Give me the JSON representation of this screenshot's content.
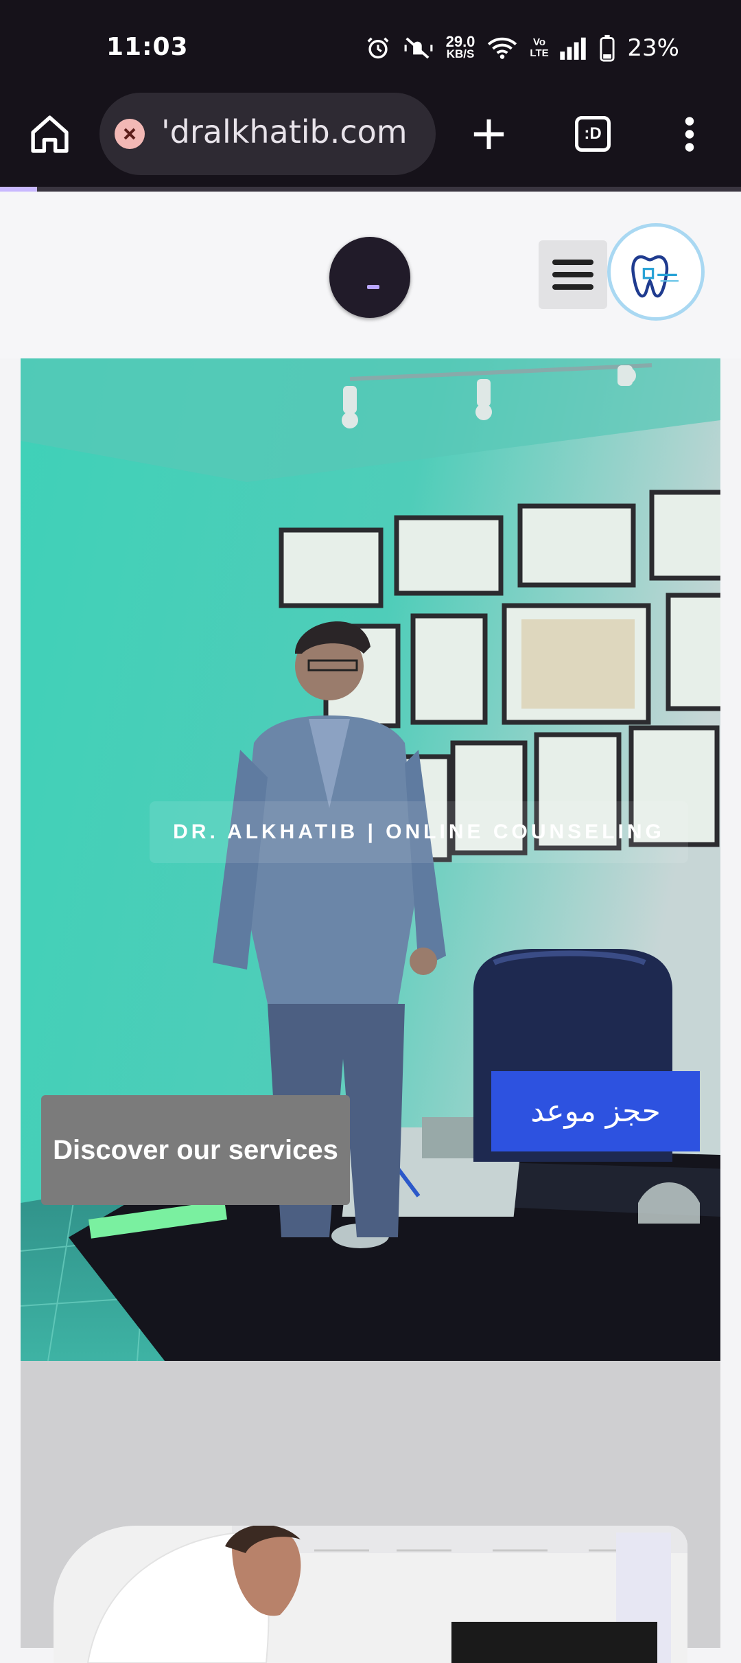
{
  "status_bar": {
    "time": "11:03",
    "net_speed_value": "29.0",
    "net_speed_unit": "KB/S",
    "volte": "Vo\nLTE",
    "battery": "23%",
    "icons": [
      "alarm-icon",
      "mute-vibrate-icon",
      "wifi-icon",
      "volte-icon",
      "signal-icon",
      "battery-icon"
    ]
  },
  "browser": {
    "url": "'dralkhatib.com",
    "tabs_label": ":D",
    "load_progress": 0.05,
    "icons": [
      "home-icon",
      "site-error-icon",
      "new-tab-icon",
      "tabs-icon",
      "more-menu-icon"
    ]
  },
  "header": {
    "menu_icon": "hamburger-icon",
    "logo": "tooth-logo"
  },
  "hero": {
    "title": "DR. ALKHATIB | ONLINE COUNSELING",
    "book_button": "حجز موعد",
    "discover_button": "Discover our services"
  },
  "colors": {
    "status_bg": "#16121a",
    "header_bg": "#f6f6f8",
    "hero_tint": "#3fd1b8",
    "book_button": "#2d52e0",
    "discover_button": "#7b7b7b",
    "section_bg": "#cfcfd1"
  }
}
